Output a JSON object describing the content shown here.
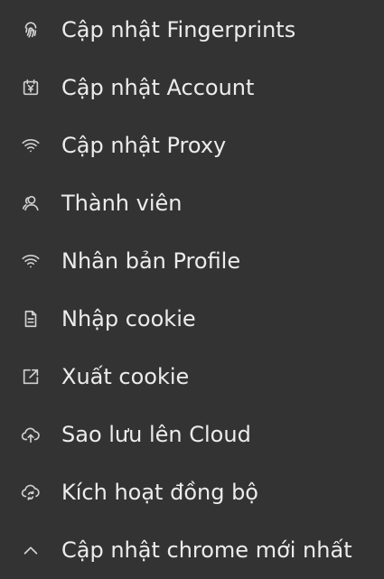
{
  "theme": {
    "background": "#333333",
    "text": "#ececec",
    "icon": "#d0d0d0"
  },
  "menu": {
    "items": [
      {
        "label": "Cập nhật Fingerprints",
        "icon": "fingerprint-icon"
      },
      {
        "label": "Cập nhật Account",
        "icon": "calendar-yen-icon"
      },
      {
        "label": "Cập nhật Proxy",
        "icon": "wifi-icon"
      },
      {
        "label": "Thành viên",
        "icon": "users-icon"
      },
      {
        "label": "Nhân bản Profile",
        "icon": "wifi-icon"
      },
      {
        "label": "Nhập cookie",
        "icon": "document-icon"
      },
      {
        "label": "Xuất cookie",
        "icon": "export-icon"
      },
      {
        "label": "Sao lưu lên Cloud",
        "icon": "cloud-upload-icon"
      },
      {
        "label": "Kích hoạt đồng bộ",
        "icon": "cloud-sync-icon"
      },
      {
        "label": "Cập nhật chrome mới nhất",
        "icon": "chevron-up-icon"
      }
    ]
  }
}
